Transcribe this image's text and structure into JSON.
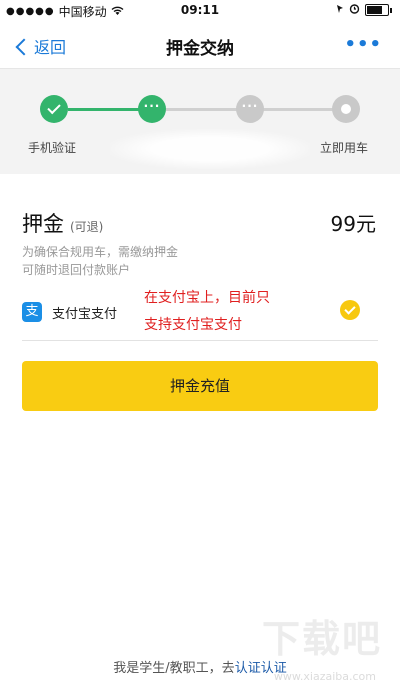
{
  "status_bar": {
    "carrier": "中国移动",
    "time": "09:11"
  },
  "nav": {
    "back_label": "返回",
    "title": "押金交纳",
    "more_label": "•••"
  },
  "steps": [
    {
      "label": "手机验证",
      "state": "done"
    },
    {
      "label": "",
      "state": "active"
    },
    {
      "label": "",
      "state": "pending"
    },
    {
      "label": "立即用车",
      "state": "pending"
    }
  ],
  "deposit": {
    "title": "押金",
    "subtitle": "(可退)",
    "amount": "99元",
    "desc_line1": "为确保合规用车，需缴纳押金",
    "desc_line2": "可随时退回付款账户"
  },
  "payment": {
    "icon_char": "支",
    "label": "支付宝支付",
    "annotation_line1": "在支付宝上，目前只",
    "annotation_line2": "支持支付宝支付"
  },
  "action": {
    "button_label": "押金充值"
  },
  "footer": {
    "prefix": "我是学生/教职工，去",
    "link": "认证认证"
  },
  "watermark": {
    "text": "下载吧",
    "url": "www.xiazaiba.com"
  },
  "colors": {
    "accent_blue": "#1b7ad8",
    "step_green": "#33b46c",
    "button_yellow": "#f9cc12",
    "annotation_red": "#e02020"
  }
}
